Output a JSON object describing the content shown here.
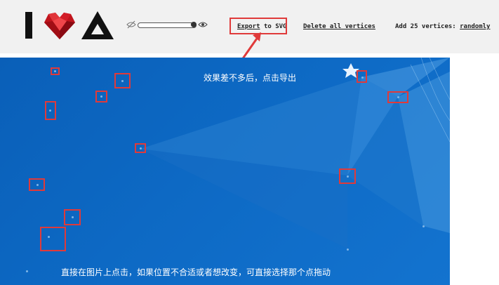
{
  "toolbar": {
    "export_link": "Export",
    "export_suffix": "to SVG",
    "delete_link": "Delete all vertices",
    "add_prefix": "Add 25 vertices:",
    "add_link": "randomly"
  },
  "annotations": {
    "top": "效果差不多后，点击导出",
    "bottom": "直接在图片上点击，如果位置不合适或者想改变，可直接选择那个点拖动"
  },
  "colors": {
    "toolbar_bg": "#f1f1f1",
    "canvas_bg": "#0d69c4",
    "annotation_red": "#e03a3a"
  },
  "icons": {
    "logo": [
      "letter-i-icon",
      "heart-gem-icon",
      "triangle-icon"
    ],
    "slider": [
      "eye-off-icon",
      "eye-icon"
    ]
  }
}
